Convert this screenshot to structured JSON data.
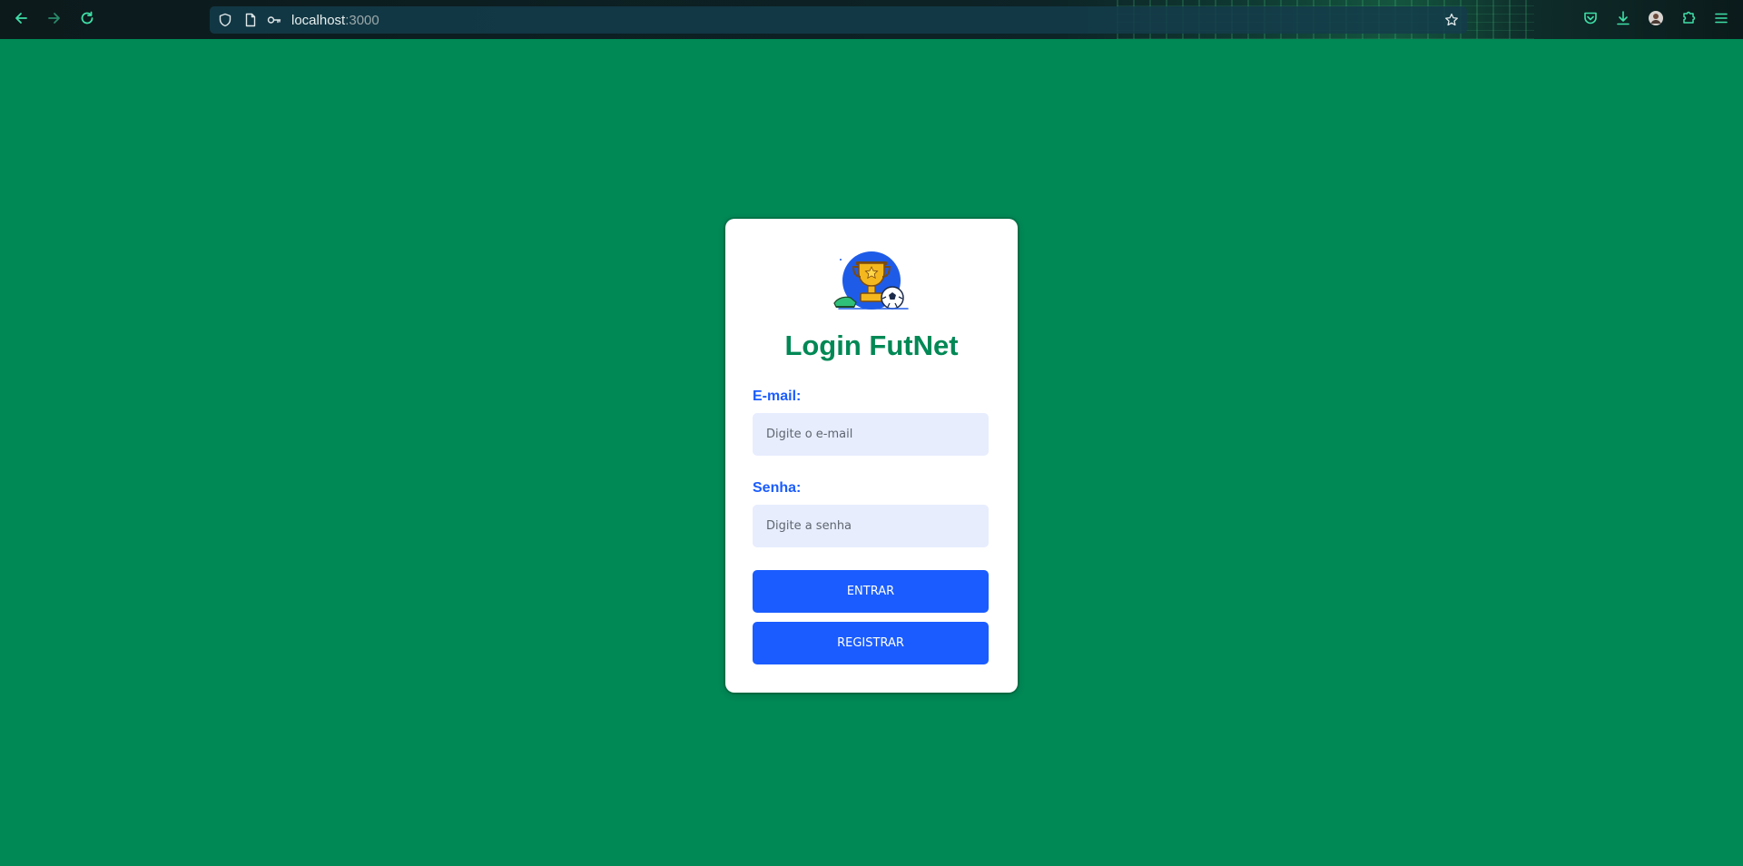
{
  "browser": {
    "url_host": "localhost",
    "url_port": ":3000",
    "icons": {
      "back": "arrow-left-icon",
      "forward": "arrow-right-icon",
      "reload": "reload-icon",
      "tracking_protection": "shield-icon",
      "page_info": "page-icon",
      "password": "key-icon",
      "bookmark": "star-icon",
      "pocket": "pocket-icon",
      "downloads": "download-icon",
      "account": "avatar-icon",
      "extensions": "puzzle-icon",
      "menu": "hamburger-menu-icon"
    }
  },
  "login": {
    "logo": "trophy-soccer-logo",
    "title": "Login FutNet",
    "email_label": "E-mail:",
    "email_placeholder": "Digite o e-mail",
    "email_value": "",
    "password_label": "Senha:",
    "password_placeholder": "Digite a senha",
    "password_value": "",
    "submit_label": "ENTRAR",
    "register_label": "REGISTRAR"
  },
  "colors": {
    "page_background": "#008855",
    "title": "#008855",
    "label": "#1a5cff",
    "button": "#1a5cff",
    "input_background": "#e7edfd",
    "card": "#ffffff"
  }
}
